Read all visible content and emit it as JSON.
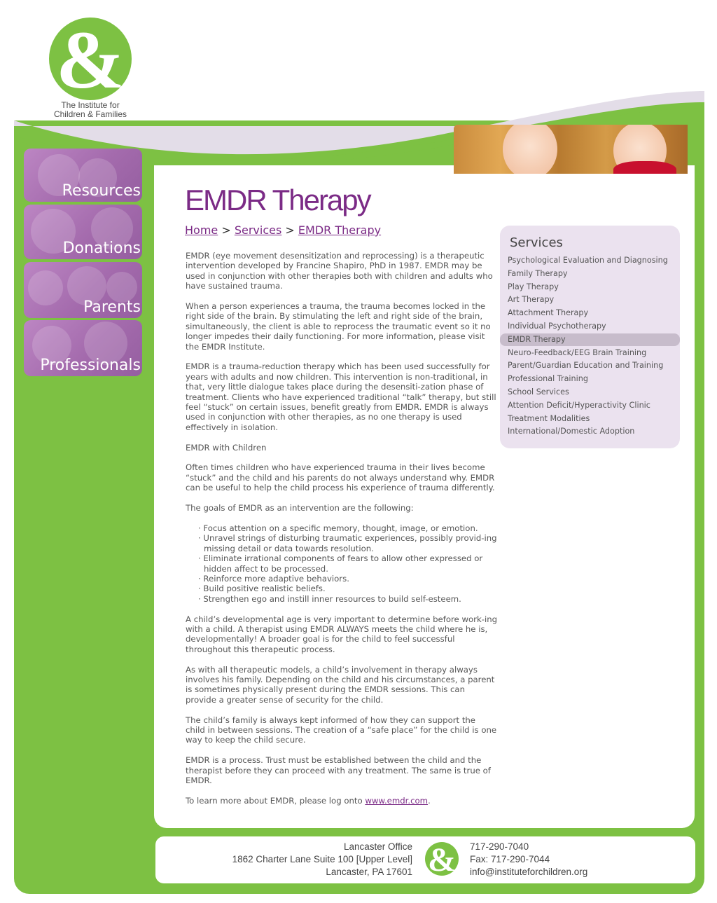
{
  "brand": {
    "logo_text_line1": "The Institute for",
    "logo_text_line2": "Children & Families",
    "logo_glyph": "&",
    "green": "#7dc143",
    "purple": "#7b2b86"
  },
  "nav": {
    "items": [
      {
        "label": "Resources"
      },
      {
        "label": "Donations"
      },
      {
        "label": "Parents"
      },
      {
        "label": "Professionals"
      }
    ]
  },
  "page": {
    "title": "EMDR Therapy",
    "breadcrumb": {
      "home": "Home",
      "separator": ">",
      "services": "Services",
      "current": "EMDR Therapy"
    },
    "paragraphs": [
      "EMDR (eye movement desensitization and reprocessing) is a therapeutic intervention developed by Francine Shapiro, PhD in 1987. EMDR may be used in conjunction with other therapies both with children and adults who have sustained trauma.",
      "When a person experiences a trauma, the trauma becomes locked in the right side of the brain. By stimulating the left and right side of the brain, simultaneously, the client is able to reprocess the traumatic event so it no longer impedes their daily functioning. For more information, please visit the EMDR Institute.",
      "EMDR is a trauma-reduction therapy which has been used successfully for years with adults and now children. This intervention is non-traditional, in that, very little dialogue takes place during the desensiti-zation phase of treatment. Clients who have experienced traditional “talk” therapy, but still feel “stuck” on certain issues, benefit greatly from EMDR. EMDR is always used in conjunction with other therapies, as no one therapy is used effectively in isolation.",
      "EMDR with Children",
      "Often times children who have experienced trauma in their lives become “stuck” and the child and his parents do not always understand why. EMDR can be useful to help the child process his experience of trauma differently.",
      "The goals of EMDR as an intervention are the following:"
    ],
    "goals": [
      "· Focus attention on a specific memory, thought, image, or emotion.",
      "· Unravel strings of disturbing traumatic experiences, possibly provid-ing missing detail or data towards resolution.",
      "· Eliminate irrational components of fears to allow other expressed or hidden affect to be processed.",
      "· Reinforce more adaptive behaviors.",
      "· Build positive realistic beliefs.",
      "· Strengthen ego and instill inner resources to build self-esteem."
    ],
    "paragraphs_after": [
      "A child’s developmental age is very important to determine before work-ing with a child. A therapist using EMDR ALWAYS meets the child where he is, developmentally! A broader goal is for the child to feel successful throughout this therapeutic process.",
      "As with all therapeutic models, a child’s involvement in therapy always involves his family. Depending on the child and his circumstances, a parent is sometimes physically present during the EMDR sessions. This can provide a greater sense of security for the child.",
      "The child’s family is always kept informed of how they can support the child in between sessions. The creation of a “safe place” for the child is one way to keep the child secure.",
      "EMDR is a process. Trust must be established between the child and the therapist before they can proceed with any treatment. The same is true of EMDR."
    ],
    "closing_prefix": "To learn more about EMDR, please log onto ",
    "closing_link": "www.emdr.com",
    "closing_suffix": "."
  },
  "services": {
    "title": "Services",
    "items": [
      "Psychological Evaluation and Diagnosing",
      "Family Therapy",
      "Play Therapy",
      "Art Therapy",
      "Attachment Therapy",
      "Individual Psychotherapy",
      "EMDR Therapy",
      "Neuro-Feedback/EEG Brain Training",
      "Parent/Guardian Education and Training",
      "Professional Training",
      "School Services",
      "Attention Deficit/Hyperactivity Clinic",
      "Treatment Modalities",
      "International/Domestic Adoption"
    ],
    "active": "EMDR Therapy"
  },
  "footer": {
    "office": "Lancaster Office",
    "address_line1": "1862 Charter Lane Suite 100 [Upper Level]",
    "address_line2": "Lancaster, PA 17601",
    "phone": "717-290-7040",
    "fax": "Fax: 717-290-7044",
    "email": "info@instituteforchildren.org"
  }
}
